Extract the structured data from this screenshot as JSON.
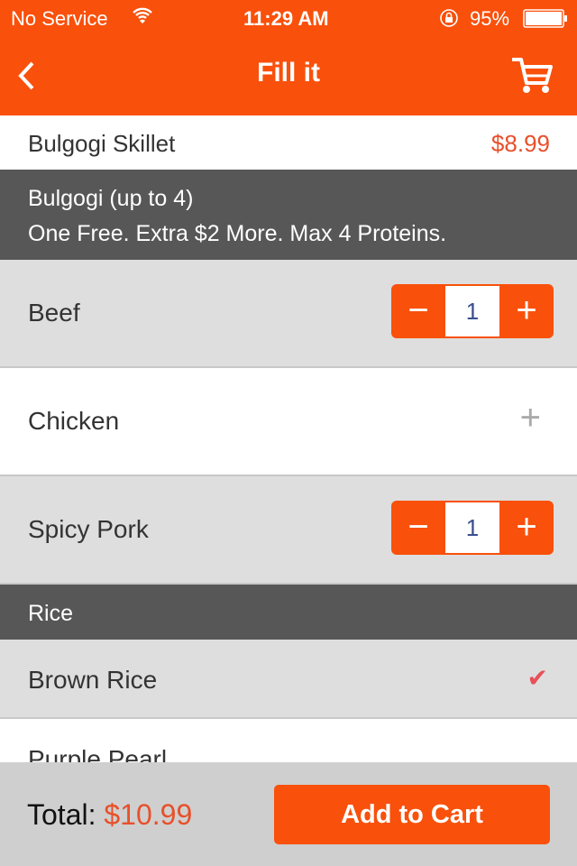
{
  "status": {
    "carrier": "No Service",
    "time": "11:29 AM",
    "battery": "95%"
  },
  "nav": {
    "title": "Fill it"
  },
  "item": {
    "name": "Bulgogi Skillet",
    "price": "$8.99"
  },
  "sections": [
    {
      "title": "Bulgogi (up to 4)",
      "subtitle": "One Free. Extra $2 More. Max 4 Proteins.",
      "options": [
        {
          "label": "Beef",
          "qty": "1"
        },
        {
          "label": "Chicken"
        },
        {
          "label": "Spicy Pork",
          "qty": "1"
        }
      ]
    },
    {
      "title": "Rice",
      "options": [
        {
          "label": "Brown Rice",
          "selected": true
        },
        {
          "label": "Purple Pearl"
        }
      ]
    }
  ],
  "footer": {
    "total_label": "Total:",
    "total": "$10.99",
    "add_label": "Add to Cart"
  },
  "colors": {
    "accent": "#f9500b",
    "price": "#e8502a",
    "check": "#e8505b"
  }
}
